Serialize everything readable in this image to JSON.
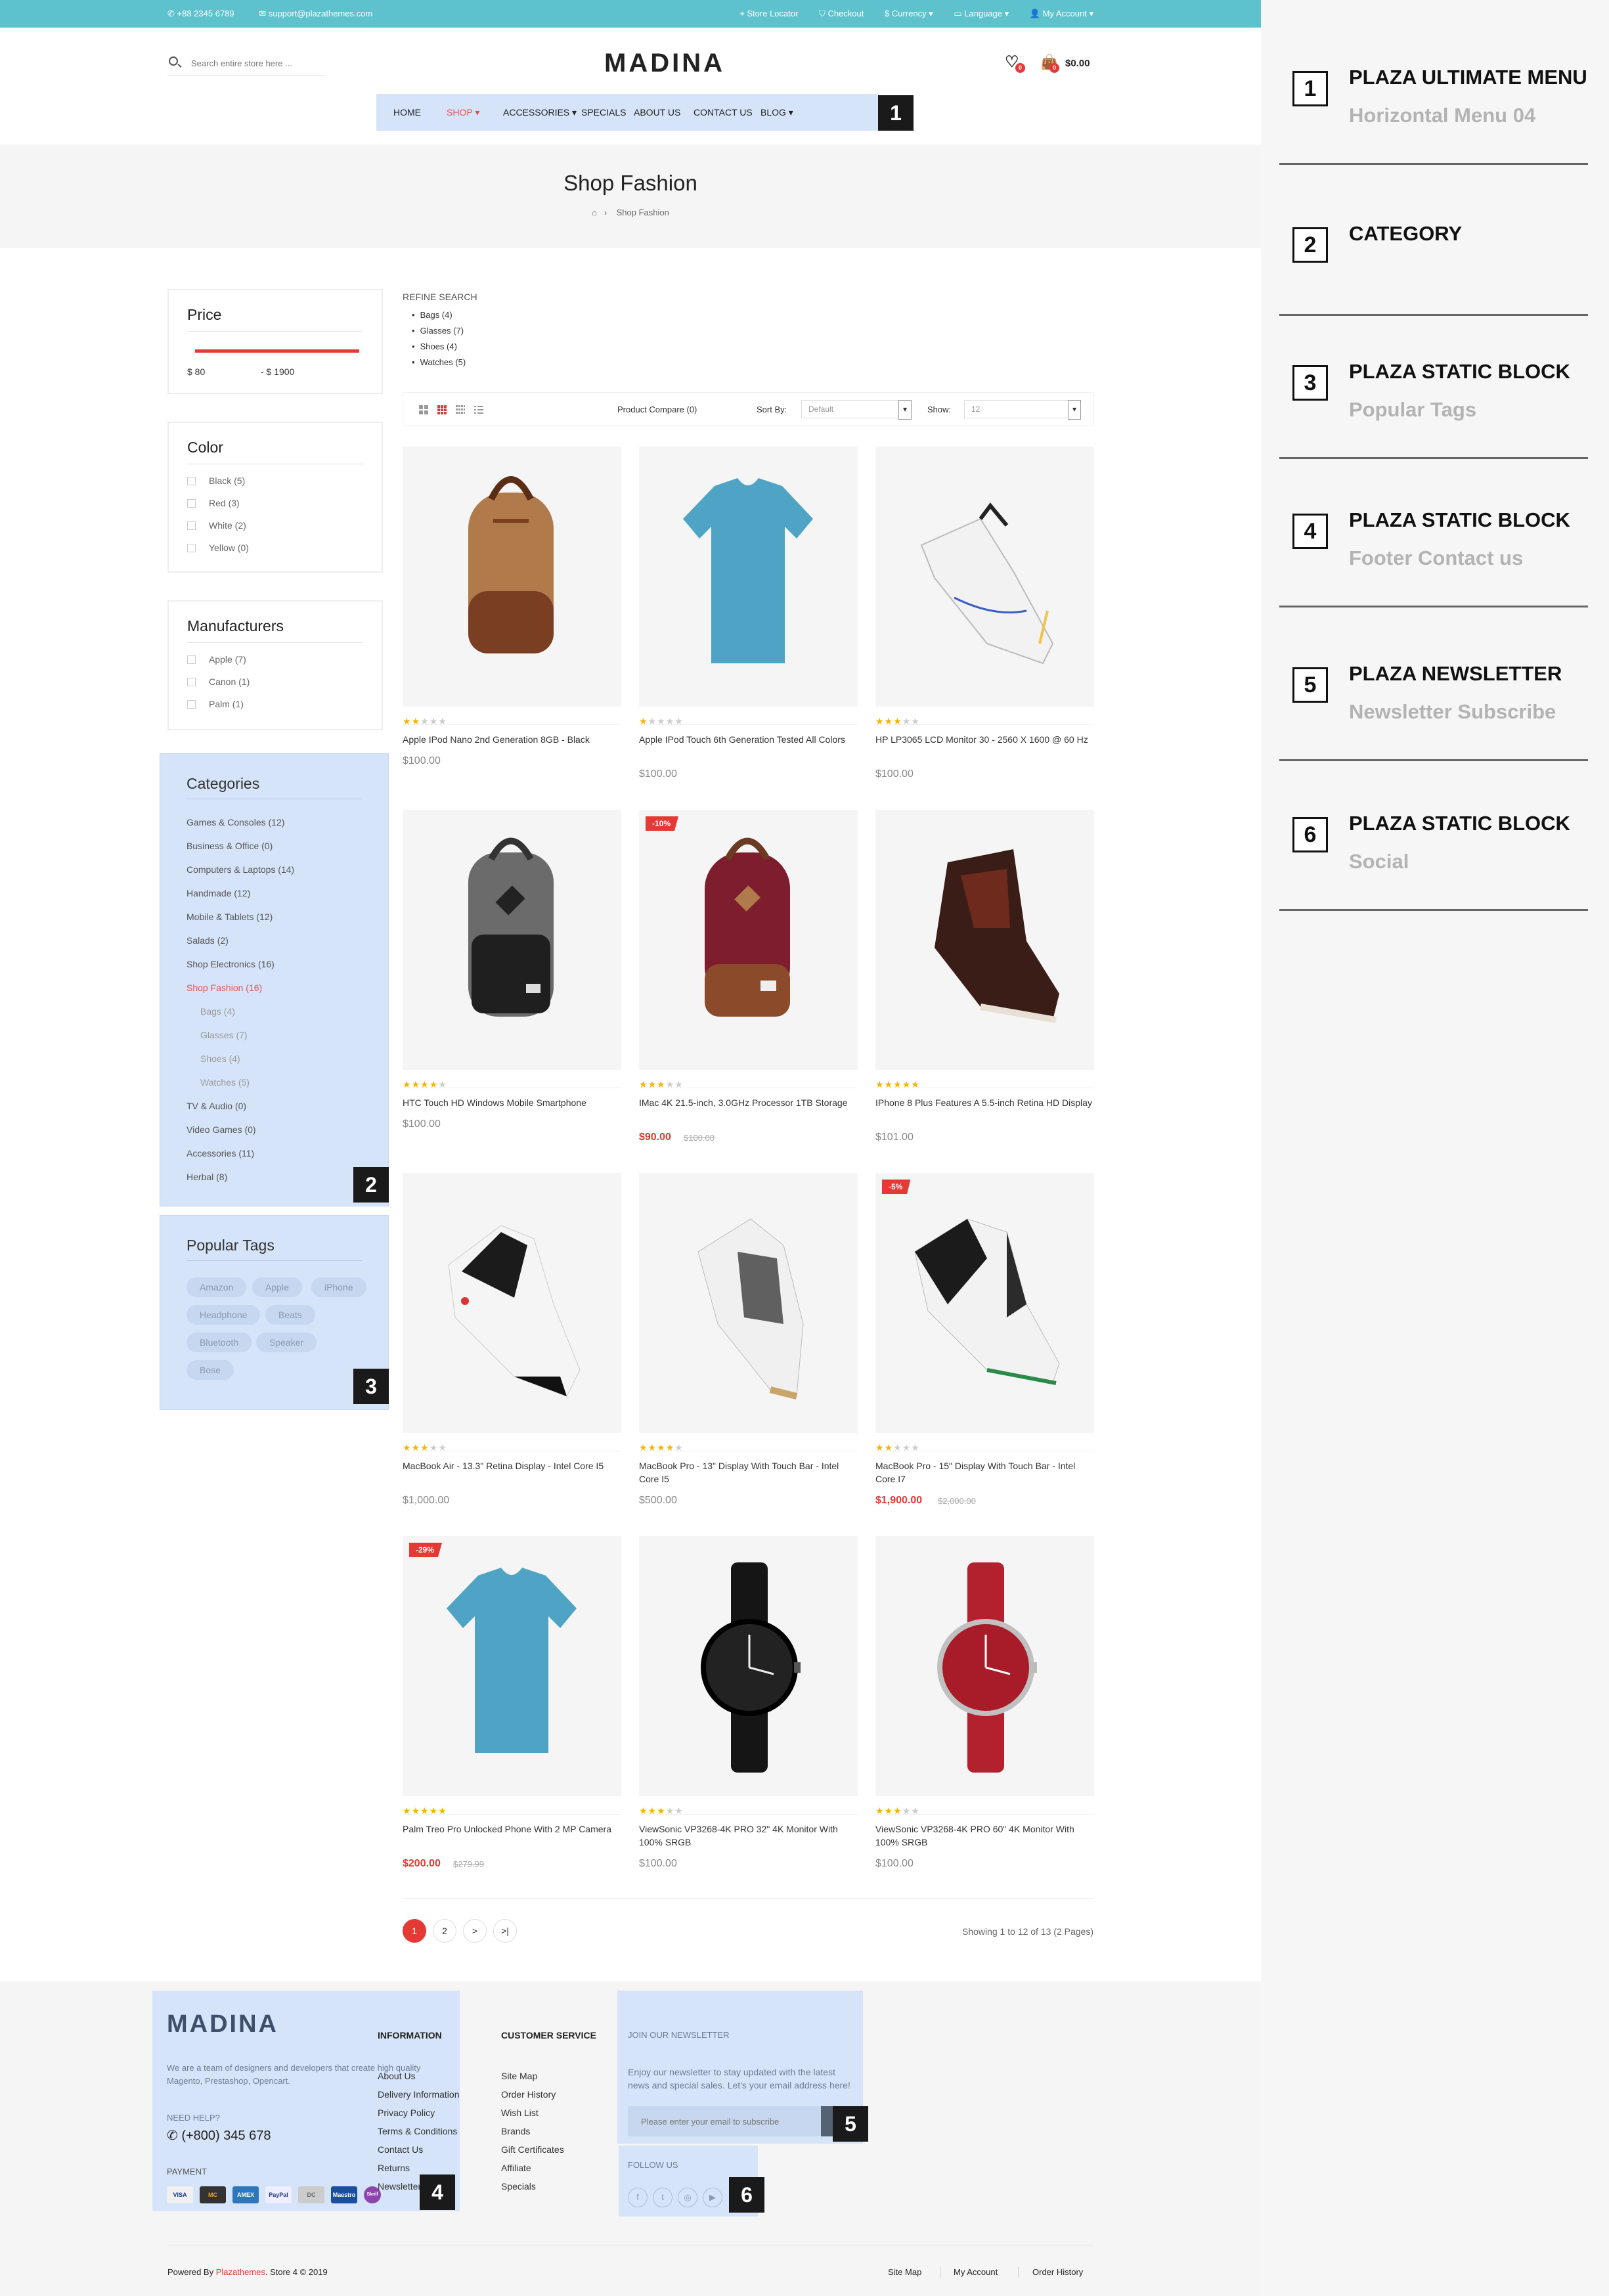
{
  "topbar": {
    "phone": "+88 2345 6789",
    "email": "support@plazathemes.com",
    "store_locator": "Store Locator",
    "checkout": "Checkout",
    "currency": "$ Currency",
    "language": "Language",
    "account": "My Account"
  },
  "header": {
    "search_placeholder": "Search entire store here ...",
    "logo": "MADINA",
    "wishlist_count": "0",
    "cart_count": "0",
    "cart_total": "$0.00"
  },
  "nav": {
    "items": [
      "HOME",
      "SHOP",
      "ACCESSORIES",
      "SPECIALS",
      "ABOUT US",
      "CONTACT US",
      "BLOG"
    ],
    "marker": "1"
  },
  "hero": {
    "title": "Shop Fashion",
    "breadcrumb": "Shop Fashion"
  },
  "filters": {
    "price": {
      "title": "Price",
      "min": "$ 80",
      "max": "- $ 1900"
    },
    "color": {
      "title": "Color",
      "options": [
        "Black (5)",
        "Red (3)",
        "White (2)",
        "Yellow (0)"
      ]
    },
    "manufacturers": {
      "title": "Manufacturers",
      "options": [
        "Apple (7)",
        "Canon (1)",
        "Palm (1)"
      ]
    }
  },
  "categories": {
    "title": "Categories",
    "marker": "2",
    "items": [
      {
        "label": "Games & Consoles (12)",
        "level": 0
      },
      {
        "label": "Business & Office (0)",
        "level": 0
      },
      {
        "label": "Computers & Laptops (14)",
        "level": 0
      },
      {
        "label": "Handmade (12)",
        "level": 0
      },
      {
        "label": "Mobile & Tablets (12)",
        "level": 0
      },
      {
        "label": "Salads (2)",
        "level": 0
      },
      {
        "label": "Shop Electronics (16)",
        "level": 0
      },
      {
        "label": "Shop Fashion (16)",
        "level": 0,
        "active": true
      },
      {
        "label": "Bags (4)",
        "level": 1
      },
      {
        "label": "Glasses (7)",
        "level": 1
      },
      {
        "label": "Shoes (4)",
        "level": 1
      },
      {
        "label": "Watches (5)",
        "level": 1
      },
      {
        "label": "TV & Audio (0)",
        "level": 0
      },
      {
        "label": "Video Games (0)",
        "level": 0
      },
      {
        "label": "Accessories (11)",
        "level": 0
      },
      {
        "label": "Herbal (8)",
        "level": 0
      }
    ]
  },
  "tags": {
    "title": "Popular Tags",
    "marker": "3",
    "items": [
      "Amazon",
      "Apple",
      "iPhone",
      "Headphone",
      "Beats",
      "Bluetooth",
      "Speaker",
      "Bose"
    ]
  },
  "refine": {
    "title": "REFINE SEARCH",
    "items": [
      "Bags (4)",
      "Glasses (7)",
      "Shoes (4)",
      "Watches (5)"
    ]
  },
  "toolbar": {
    "compare": "Product Compare (0)",
    "sort_label": "Sort By:",
    "sort_value": "Default",
    "show_label": "Show:",
    "show_value": "12"
  },
  "products": [
    {
      "name": "Apple IPod Nano 2nd Generation 8GB - Black",
      "price": "$100.00",
      "old": "",
      "rating": 2,
      "discount": "",
      "img": "backpack-brown"
    },
    {
      "name": "Apple IPod Touch 6th Generation Tested All Colors",
      "price": "$100.00",
      "old": "",
      "rating": 1,
      "discount": "",
      "img": "tshirt"
    },
    {
      "name": "HP LP3065 LCD Monitor 30 - 2560 X 1600 @ 60 Hz",
      "price": "$100.00",
      "old": "",
      "rating": 3,
      "discount": "",
      "img": "sneaker-white"
    },
    {
      "name": "HTC Touch HD Windows Mobile Smartphone",
      "price": "$100.00",
      "old": "",
      "rating": 4,
      "discount": "",
      "img": "backpack-grey"
    },
    {
      "name": "IMac 4K 21.5-inch, 3.0GHz Processor 1TB Storage",
      "price": "$90.00",
      "old": "$100.00",
      "rating": 3,
      "discount": "-10%",
      "img": "backpack-red"
    },
    {
      "name": "IPhone 8 Plus Features A 5.5-inch Retina HD Display",
      "price": "$101.00",
      "old": "",
      "rating": 5,
      "discount": "",
      "img": "hightop-dark"
    },
    {
      "name": "MacBook Air - 13.3\" Retina Display - Intel Core I5",
      "price": "$1,000.00",
      "old": "",
      "rating": 3,
      "discount": "",
      "img": "basketball-shoe"
    },
    {
      "name": "MacBook Pro - 13\" Display With Touch Bar - Intel Core I5",
      "price": "$500.00",
      "old": "",
      "rating": 4,
      "discount": "",
      "img": "running-shoe"
    },
    {
      "name": "MacBook Pro - 15\" Display With Touch Bar - Intel Core I7",
      "price": "$1,900.00",
      "old": "$2,000.00",
      "rating": 2,
      "discount": "-5%",
      "img": "retro-shoe"
    },
    {
      "name": "Palm Treo Pro Unlocked Phone With 2 MP Camera",
      "price": "$200.00",
      "old": "$279.99",
      "rating": 5,
      "discount": "-29%",
      "img": "tshirt"
    },
    {
      "name": "ViewSonic VP3268-4K PRO 32\" 4K Monitor With 100% SRGB",
      "price": "$100.00",
      "old": "",
      "rating": 3,
      "discount": "",
      "img": "watch-black"
    },
    {
      "name": "ViewSonic VP3268-4K PRO 60\" 4K Monitor With 100% SRGB",
      "price": "$100.00",
      "old": "",
      "rating": 3,
      "discount": "",
      "img": "watch-red"
    }
  ],
  "pagination": {
    "pages": [
      "1",
      "2",
      ">",
      ">|"
    ],
    "showing": "Showing 1 to 12 of 13 (2 Pages)"
  },
  "footer": {
    "logo": "MADINA",
    "about": "We are a team of designers and developers that create high quality Magento, Prestashop, Opencart.",
    "need_help": "NEED HELP?",
    "phone": "(+800) 345 678",
    "payment": "PAYMENT",
    "cards": [
      "VISA",
      "MC",
      "AMEX",
      "PayPal",
      "DC",
      "Maestro",
      "Skrill"
    ],
    "marker4": "4",
    "info_title": "INFORMATION",
    "info_links": [
      "About Us",
      "Delivery Information",
      "Privacy Policy",
      "Terms & Conditions",
      "Contact Us",
      "Returns",
      "Newsletter"
    ],
    "service_title": "CUSTOMER SERVICE",
    "service_links": [
      "Site Map",
      "Order History",
      "Wish List",
      "Brands",
      "Gift Certificates",
      "Affiliate",
      "Specials"
    ],
    "newsletter_title": "JOIN OUR NEWSLETTER",
    "newsletter_text": "Enjoy our newsletter to stay updated with the latest news and special sales. Let's your email address here!",
    "newsletter_placeholder": "Please enter your email to subscribe",
    "marker5": "5",
    "follow_title": "FOLLOW US",
    "marker6": "6",
    "powered_prefix": "Powered By ",
    "powered_brand": "Plazathemes",
    "powered_suffix": ". Store 4 © 2019",
    "bottom_links": [
      "Site Map",
      "My Account",
      "Order History"
    ]
  },
  "legend": [
    {
      "n": "1",
      "title": "PLAZA ULTIMATE MENU",
      "sub": "Horizontal Menu 04"
    },
    {
      "n": "2",
      "title": "CATEGORY",
      "sub": ""
    },
    {
      "n": "3",
      "title": "PLAZA STATIC BLOCK",
      "sub": "Popular Tags"
    },
    {
      "n": "4",
      "title": "PLAZA STATIC BLOCK",
      "sub": "Footer Contact us"
    },
    {
      "n": "5",
      "title": "PLAZA NEWSLETTER",
      "sub": "Newsletter Subscribe"
    },
    {
      "n": "6",
      "title": "PLAZA STATIC BLOCK",
      "sub": "Social"
    }
  ],
  "colors": {
    "accent": "#e53935",
    "topbar": "#5ec2cd",
    "highlight": "#d6e4f9"
  }
}
